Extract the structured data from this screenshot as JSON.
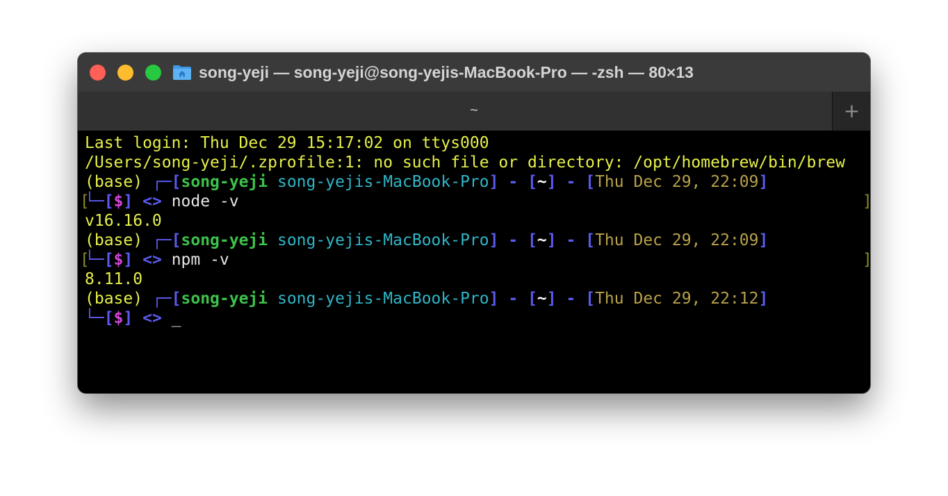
{
  "window": {
    "title": "song-yeji — song-yeji@song-yejis-MacBook-Pro — -zsh — 80×13",
    "tab_label": "~",
    "new_tab_glyph": "+"
  },
  "terminal": {
    "last_login": "Last login: Thu Dec 29 15:17:02 on ttys000",
    "error_line": "/Users/song-yeji/.zprofile:1: no such file or directory: /opt/homebrew/bin/brew",
    "prompt": {
      "env": "(base)",
      "user": "song-yeji",
      "host": "song-yejis-MacBook-Pro",
      "dir": "~",
      "sep": "-",
      "symbol": "$",
      "arrows": "<>"
    },
    "entries": [
      {
        "time": "Thu Dec 29, 22:09",
        "command": "node -v",
        "output": "v16.16.0"
      },
      {
        "time": "Thu Dec 29, 22:09",
        "command": "npm -v",
        "output": "8.11.0"
      },
      {
        "time": "Thu Dec 29, 22:12",
        "command": "",
        "cursor": "_"
      }
    ]
  },
  "colors": {
    "yellow_text": "#e6f04a",
    "bracket_blue": "#5b5bf0",
    "user_green": "#3ec24a",
    "host_cyan": "#2fb6c8",
    "time_olive": "#b8a24a",
    "dollar_magenta": "#d146d6"
  }
}
